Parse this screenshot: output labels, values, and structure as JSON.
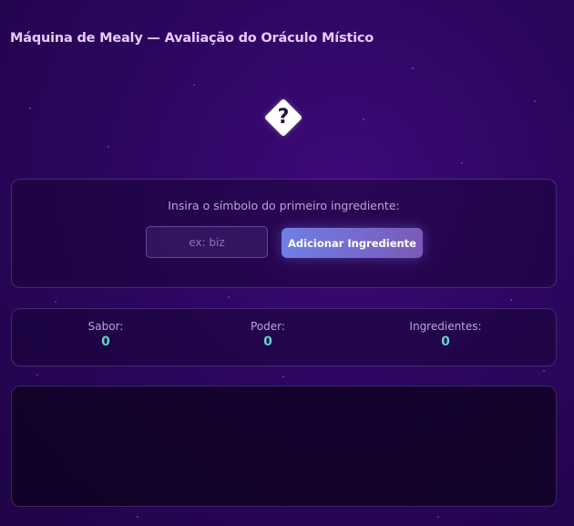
{
  "header": {
    "title": "Máquina de Mealy — Avaliação do Oráculo Místico"
  },
  "oracle": {
    "symbol": "?",
    "icon": "question-diamond-icon"
  },
  "input_panel": {
    "prompt": "Insira o símbolo do primeiro ingrediente:",
    "placeholder": "ex: biz",
    "value": "",
    "add_button_label": "Adicionar Ingrediente"
  },
  "stats": {
    "flavor": {
      "label": "Sabor:",
      "value": "0"
    },
    "power": {
      "label": "Poder:",
      "value": "0"
    },
    "ingredients": {
      "label": "Ingredientes:",
      "value": "0"
    }
  },
  "log": {
    "entries": []
  },
  "colors": {
    "background": "#2c0660",
    "accent": "#6f7fe6",
    "stat_value": "#5fd4c7"
  }
}
